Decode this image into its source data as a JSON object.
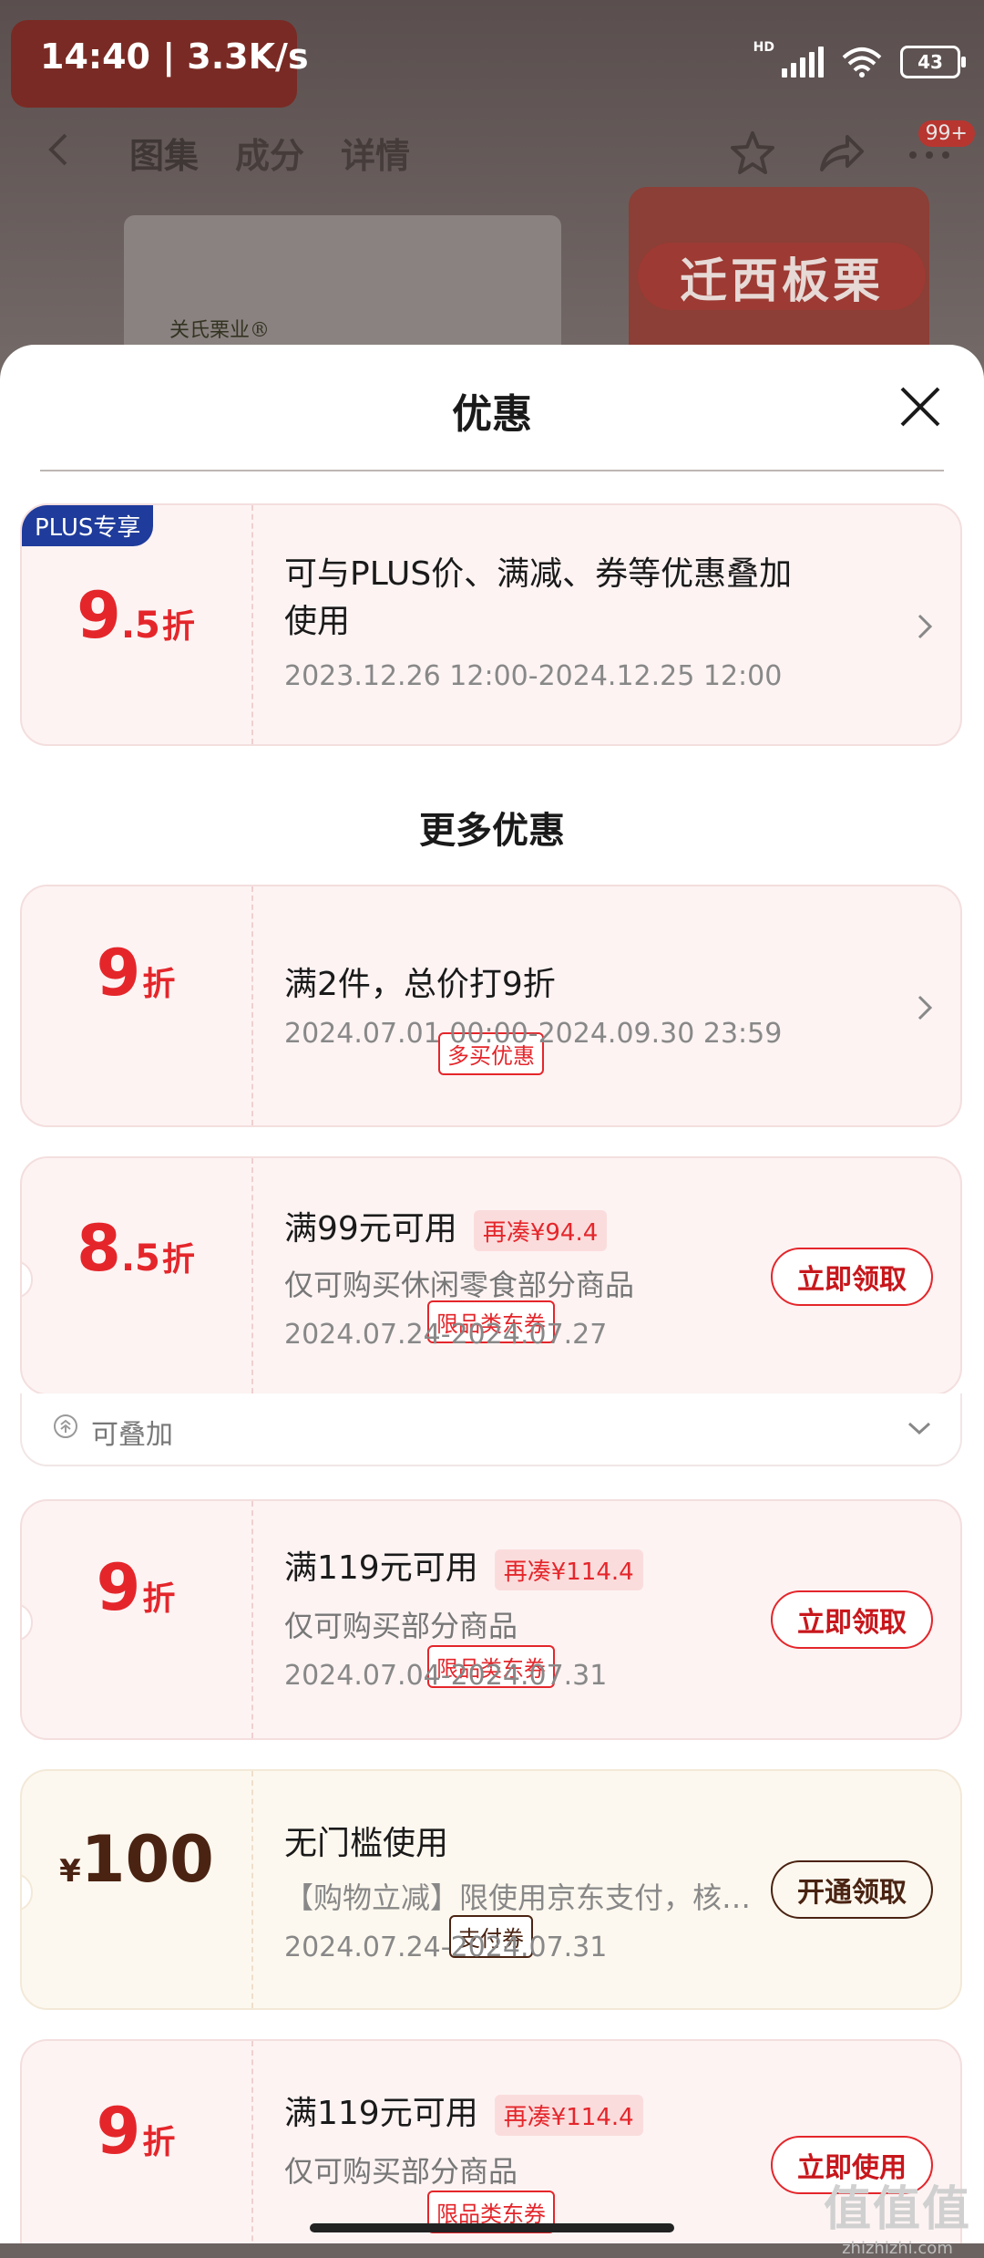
{
  "status": {
    "time": "14:40 | 3.3K/s",
    "hd": "HD",
    "battery": "43"
  },
  "nav": {
    "tabs": [
      "图集",
      "成分",
      "详情"
    ],
    "badge": "99+"
  },
  "background": {
    "banner_title": "迁西板栗",
    "logo_text": "关氏栗业®"
  },
  "sheet": {
    "title": "优惠"
  },
  "plus_card": {
    "tag": "PLUS专享",
    "num": "9",
    "dec": ".5",
    "unit": "折",
    "title": "可与PLUS价、满减、券等优惠叠加使用",
    "time": "2023.12.26 12:00-2024.12.25 12:00"
  },
  "more_title": "更多优惠",
  "cards": [
    {
      "num": "9",
      "dec": "",
      "unit": "折",
      "tag": "多买优惠",
      "title": "满2件，总价打9折",
      "time": "2024.07.01 00:00-2024.09.30 23:59"
    },
    {
      "num": "8",
      "dec": ".5",
      "unit": "折",
      "tag": "限品类东券",
      "title": "满99元可用",
      "need": "再凑¥94.4",
      "sub": "仅可购买休闲零食部分商品",
      "time": "2024.07.24-2024.07.27",
      "button": "立即领取"
    },
    {
      "num": "9",
      "dec": "",
      "unit": "折",
      "tag": "限品类东券",
      "title": "满119元可用",
      "need": "再凑¥114.4",
      "sub": "仅可购买部分商品",
      "time": "2024.07.04-2024.07.31",
      "button": "立即领取"
    },
    {
      "currency": "¥",
      "num": "100",
      "tag": "支付券",
      "title": "无门槛使用",
      "sub": "【购物立减】限使用京东支付，核…",
      "time": "2024.07.24-2024.07.31",
      "button": "开通领取"
    },
    {
      "num": "9",
      "dec": "",
      "unit": "折",
      "tag": "限品类东券",
      "title": "满119元可用",
      "need": "再凑¥114.4",
      "sub": "仅可购买部分商品",
      "button": "立即使用"
    }
  ],
  "stack_label": "可叠加",
  "watermark": {
    "big": "值值值",
    "small": "zhizhizhi.com"
  },
  "colors": {
    "accent": "#e4262b",
    "plus_blue": "#1f3b9b",
    "card_bg": "#fdf3f3",
    "cream_bg": "#fdf8ef",
    "brown": "#4a2312"
  }
}
